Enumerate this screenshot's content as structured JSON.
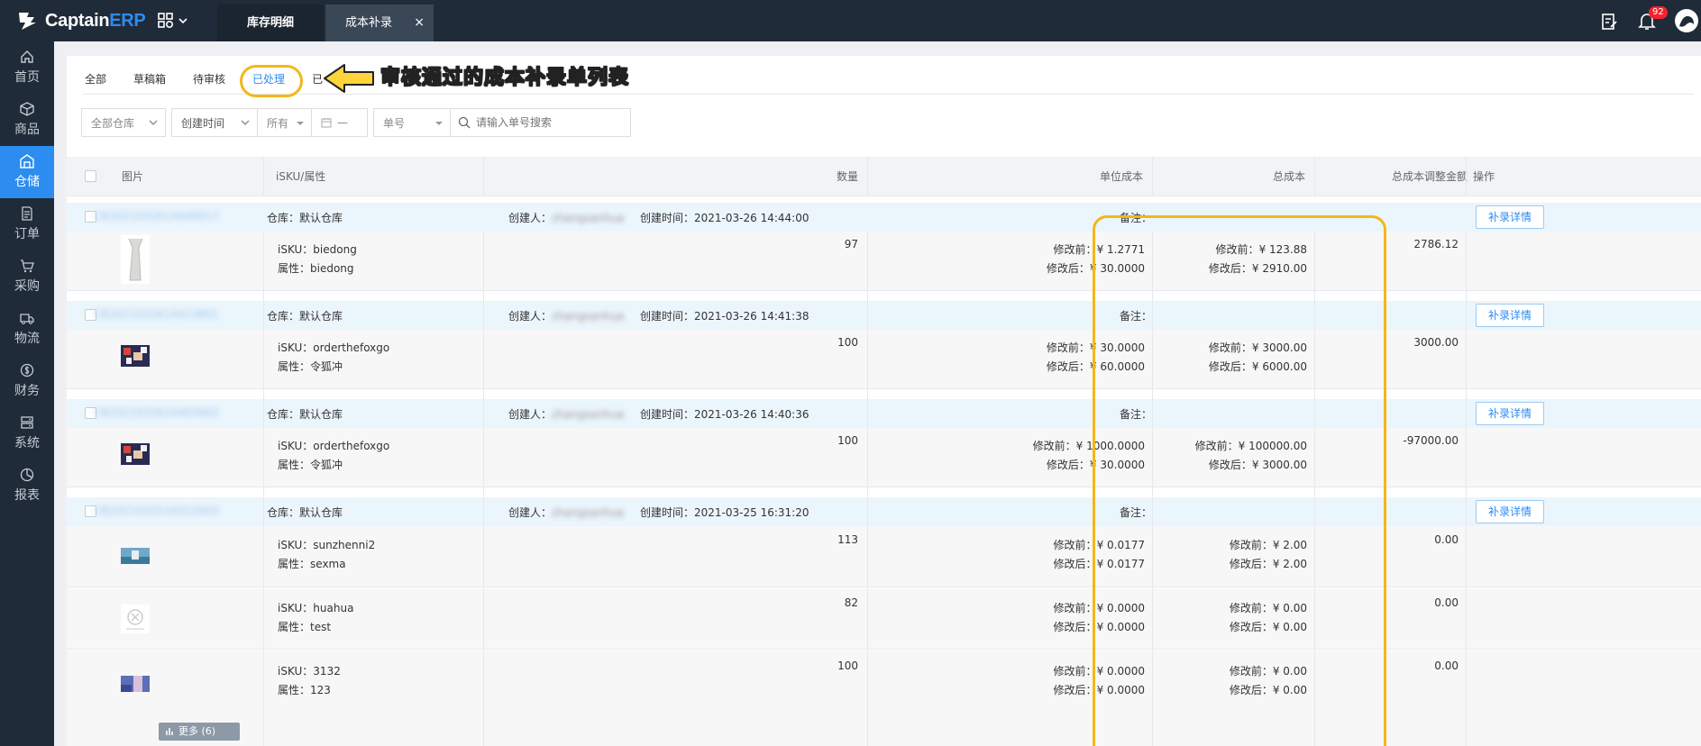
{
  "topbar": {
    "logo_prefix": "Captain",
    "logo_suffix": "ERP",
    "tabs": [
      {
        "label": "库存明细"
      },
      {
        "label": "成本补录"
      }
    ],
    "close_glyph": "×",
    "notification_count": "92"
  },
  "sidebar": {
    "items": [
      {
        "label": "首页",
        "icon": "home-icon"
      },
      {
        "label": "商品",
        "icon": "box-icon"
      },
      {
        "label": "仓储",
        "icon": "warehouse-icon",
        "active": true
      },
      {
        "label": "订单",
        "icon": "document-icon"
      },
      {
        "label": "采购",
        "icon": "cart-icon"
      },
      {
        "label": "物流",
        "icon": "truck-icon"
      },
      {
        "label": "财务",
        "icon": "money-icon"
      },
      {
        "label": "系统",
        "icon": "system-icon"
      },
      {
        "label": "报表",
        "icon": "chart-icon"
      }
    ]
  },
  "status_tabs": [
    {
      "label": "全部"
    },
    {
      "label": "草稿箱"
    },
    {
      "label": "待审核"
    },
    {
      "label": "已处理",
      "active": true
    },
    {
      "label": "已"
    }
  ],
  "annotation": "审核通过的成本补录单列表",
  "filters": {
    "warehouse": "全部仓库",
    "time_type": "创建时间",
    "range": "所有",
    "date": "—",
    "no_type": "单号",
    "search_placeholder": "请输入单号搜索"
  },
  "table": {
    "headers": {
      "image": "图片",
      "sku": "iSKU/属性",
      "qty": "数量",
      "unit_cost": "单位成本",
      "total_cost": "总成本",
      "adjust": "总成本调整金额",
      "action": "操作"
    },
    "labels": {
      "warehouse": "仓库：",
      "creator": "创建人：",
      "created": "创建时间：",
      "remark": "备注：",
      "isku": "iSKU：",
      "attr": "属性：",
      "before": "修改前：",
      "after": "修改后：",
      "detail_btn": "补录详情"
    },
    "orders": [
      {
        "order_no": "CB2021032614440017",
        "warehouse": "默认仓库",
        "creator": "zhangsanhua",
        "created": "2021-03-26 14:44:00",
        "adjust": "2786.12",
        "items": [
          {
            "isku": "biedong",
            "attr": "biedong",
            "qty": "97",
            "unit_before": "¥ 1.2771",
            "unit_after": "¥ 30.0000",
            "total_before": "¥ 123.88",
            "total_after": "¥ 2910.00"
          }
        ]
      },
      {
        "order_no": "CB2021032614413801",
        "warehouse": "默认仓库",
        "creator": "zhangsanhua",
        "created": "2021-03-26 14:41:38",
        "adjust": "3000.00",
        "items": [
          {
            "isku": "orderthefoxgo",
            "attr": "令狐冲",
            "qty": "100",
            "unit_before": "¥ 30.0000",
            "unit_after": "¥ 60.0000",
            "total_before": "¥ 3000.00",
            "total_after": "¥ 6000.00"
          }
        ]
      },
      {
        "order_no": "CB2021032614403602",
        "warehouse": "默认仓库",
        "creator": "zhangsanhua",
        "created": "2021-03-26 14:40:36",
        "adjust": "-97000.00",
        "items": [
          {
            "isku": "orderthefoxgo",
            "attr": "令狐冲",
            "qty": "100",
            "unit_before": "¥ 1000.0000",
            "unit_after": "¥ 30.0000",
            "total_before": "¥ 100000.00",
            "total_after": "¥ 3000.00"
          }
        ]
      },
      {
        "order_no": "CB2021032516312003",
        "warehouse": "默认仓库",
        "creator": "zhangsanhua",
        "created": "2021-03-25 16:31:20",
        "adjust": "0.00",
        "items": [
          {
            "isku": "sunzhenni2",
            "attr": "sexma",
            "qty": "113",
            "unit_before": "¥ 0.0177",
            "unit_after": "¥ 0.0177",
            "total_before": "¥ 2.00",
            "total_after": "¥ 2.00",
            "adjust": "0.00"
          },
          {
            "isku": "huahua",
            "attr": "test",
            "qty": "82",
            "unit_before": "¥ 0.0000",
            "unit_after": "¥ 0.0000",
            "total_before": "¥ 0.00",
            "total_after": "¥ 0.00",
            "adjust": "0.00"
          },
          {
            "isku": "3132",
            "attr": "123",
            "qty": "100",
            "unit_before": "¥ 0.0000",
            "unit_after": "¥ 0.0000",
            "total_before": "¥ 0.00",
            "total_after": "¥ 0.00",
            "adjust": "0.00"
          }
        ]
      }
    ],
    "more_label": "更多 (6)"
  },
  "colors": {
    "accent": "#2d8cf0",
    "sidebar": "#1f2b38",
    "highlight": "#f2b71c"
  }
}
